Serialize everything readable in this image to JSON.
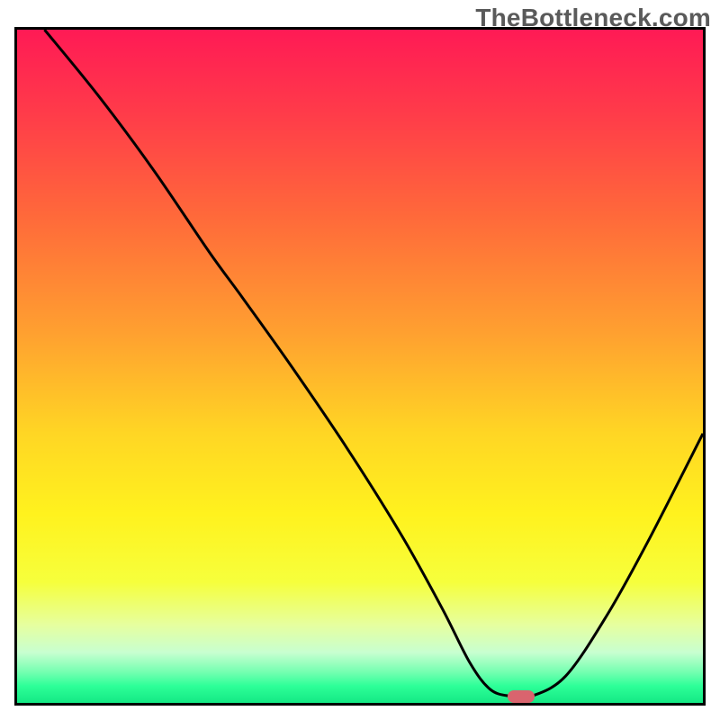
{
  "watermark": "TheBottleneck.com",
  "colors": {
    "axis": "#000000",
    "line": "#000000",
    "marker": "#d9646e",
    "gradient_stops": [
      {
        "offset": 0.0,
        "color": "#ff1a55"
      },
      {
        "offset": 0.12,
        "color": "#ff3a4a"
      },
      {
        "offset": 0.28,
        "color": "#ff6a3a"
      },
      {
        "offset": 0.45,
        "color": "#ffa030"
      },
      {
        "offset": 0.6,
        "color": "#ffd624"
      },
      {
        "offset": 0.72,
        "color": "#fff21e"
      },
      {
        "offset": 0.82,
        "color": "#f6ff3c"
      },
      {
        "offset": 0.885,
        "color": "#e6ffa0"
      },
      {
        "offset": 0.925,
        "color": "#c8ffd0"
      },
      {
        "offset": 0.955,
        "color": "#72ffb0"
      },
      {
        "offset": 0.975,
        "color": "#2dff98"
      },
      {
        "offset": 1.0,
        "color": "#14e884"
      }
    ]
  },
  "chart_data": {
    "type": "line",
    "title": "",
    "xlabel": "",
    "ylabel": "",
    "xlim": [
      0,
      100
    ],
    "ylim": [
      0,
      100
    ],
    "grid": false,
    "legend": null,
    "series": [
      {
        "name": "curve",
        "x": [
          4,
          12,
          20,
          28,
          33,
          40,
          48,
          56,
          62,
          66,
          69,
          72,
          75,
          80,
          86,
          92,
          100
        ],
        "y": [
          100,
          90,
          79,
          67,
          60,
          50,
          38,
          25,
          14,
          6,
          2,
          1,
          1,
          4,
          13,
          24,
          40
        ]
      }
    ],
    "marker": {
      "x": 73.5,
      "y": 1
    }
  }
}
